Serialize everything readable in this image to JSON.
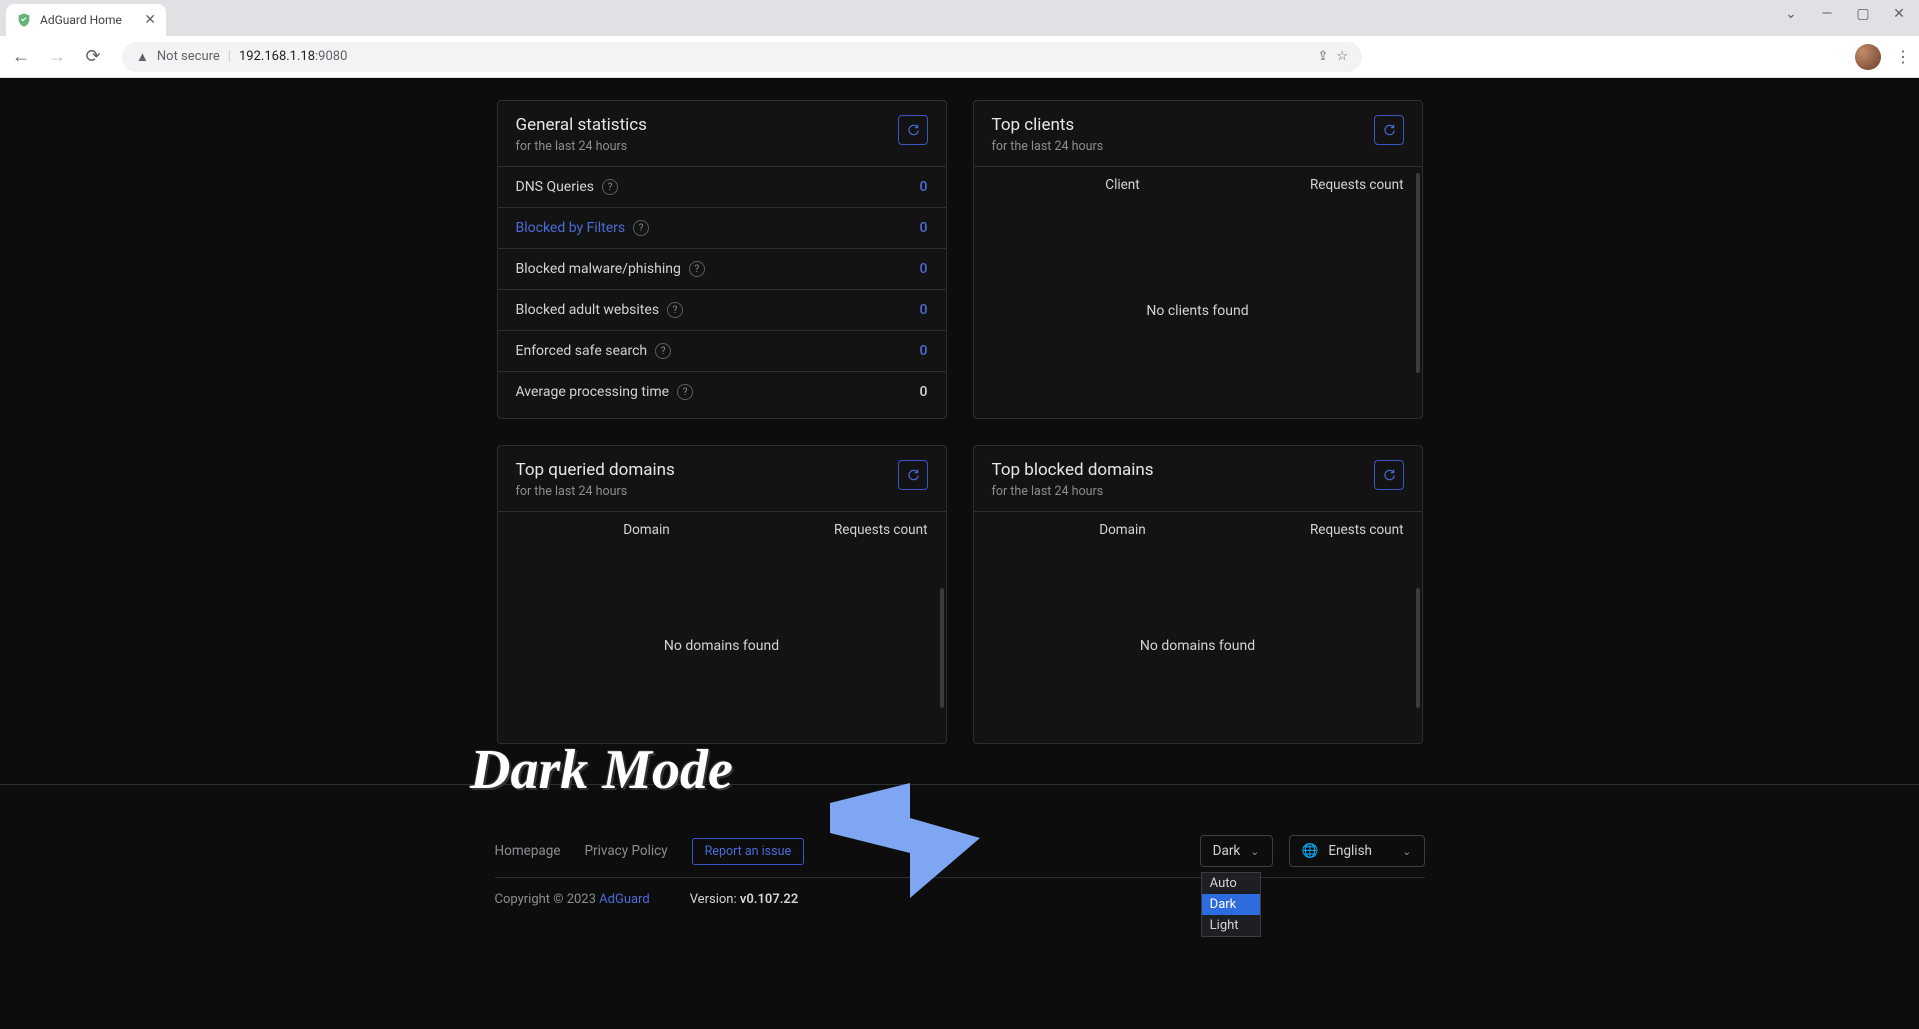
{
  "browser": {
    "tab_title": "AdGuard Home",
    "security_label": "Not secure",
    "url_host": "192.168.1.18",
    "url_port": ":9080"
  },
  "cards": {
    "general": {
      "title": "General statistics",
      "sub": "for the last 24 hours",
      "rows": [
        {
          "label": "DNS Queries",
          "value": "0",
          "link": false,
          "help": true,
          "plain": false
        },
        {
          "label": "Blocked by Filters",
          "value": "0",
          "link": true,
          "help": true,
          "plain": false
        },
        {
          "label": "Blocked malware/phishing",
          "value": "0",
          "link": false,
          "help": true,
          "plain": false
        },
        {
          "label": "Blocked adult websites",
          "value": "0",
          "link": false,
          "help": true,
          "plain": false
        },
        {
          "label": "Enforced safe search",
          "value": "0",
          "link": false,
          "help": true,
          "plain": false
        },
        {
          "label": "Average processing time",
          "value": "0",
          "link": false,
          "help": true,
          "plain": true
        }
      ]
    },
    "clients": {
      "title": "Top clients",
      "sub": "for the last 24 hours",
      "col1": "Client",
      "col2": "Requests count",
      "empty": "No clients found"
    },
    "queried": {
      "title": "Top queried domains",
      "sub": "for the last 24 hours",
      "col1": "Domain",
      "col2": "Requests count",
      "empty": "No domains found"
    },
    "blocked": {
      "title": "Top blocked domains",
      "sub": "for the last 24 hours",
      "col1": "Domain",
      "col2": "Requests count",
      "empty": "No domains found"
    }
  },
  "footer": {
    "links": {
      "home": "Homepage",
      "privacy": "Privacy Policy",
      "issue": "Report an issue"
    },
    "theme_selected": "Dark",
    "theme_options": [
      "Auto",
      "Dark",
      "Light"
    ],
    "theme_selected_index": 1,
    "lang_selected": "English",
    "copyright_prefix": "Copyright © 2023 ",
    "copyright_brand": "AdGuard",
    "version_label": "Version: ",
    "version_value": "v0.107.22"
  },
  "annotation": "Dark Mode"
}
